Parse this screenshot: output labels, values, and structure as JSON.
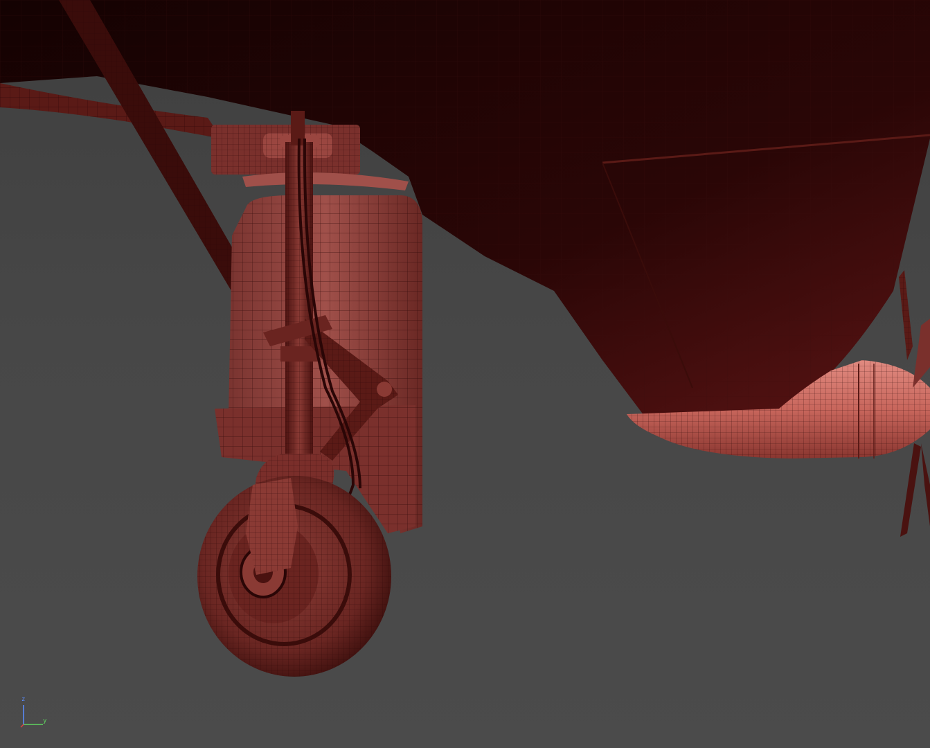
{
  "viewport": {
    "mode": "wireframe-on-shaded",
    "subject": "aircraft-main-landing-gear",
    "colors": {
      "background_top": "#3f3f3f",
      "background_bottom": "#4b4b4b",
      "mesh_dark": "#1a0404",
      "mesh_mid": "#5a1a1a",
      "mesh_light": "#a8504a",
      "mesh_highlight": "#d87a70",
      "wire": "#2a0606",
      "axis_x": "#e04040",
      "axis_y": "#5fd35f",
      "axis_z": "#5a8cff"
    }
  },
  "gizmo": {
    "z_label": "z",
    "y_label": "y"
  }
}
